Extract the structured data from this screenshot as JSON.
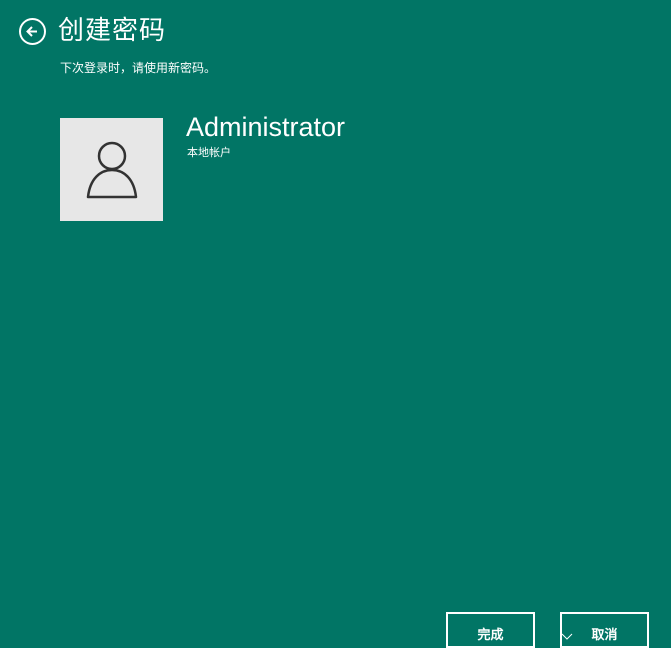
{
  "header": {
    "title": "创建密码",
    "back_icon": "back-arrow-circle-icon"
  },
  "subtitle": "下次登录时，请使用新密码。",
  "user": {
    "avatar_icon": "user-icon",
    "name": "Administrator",
    "account_type": "本地帐户"
  },
  "actions": {
    "finish_label": "完成",
    "cancel_label": "取消"
  },
  "colors": {
    "background": "#017565",
    "text": "#ffffff",
    "avatar_bg": "#e7e7e7",
    "avatar_icon": "#333333"
  }
}
